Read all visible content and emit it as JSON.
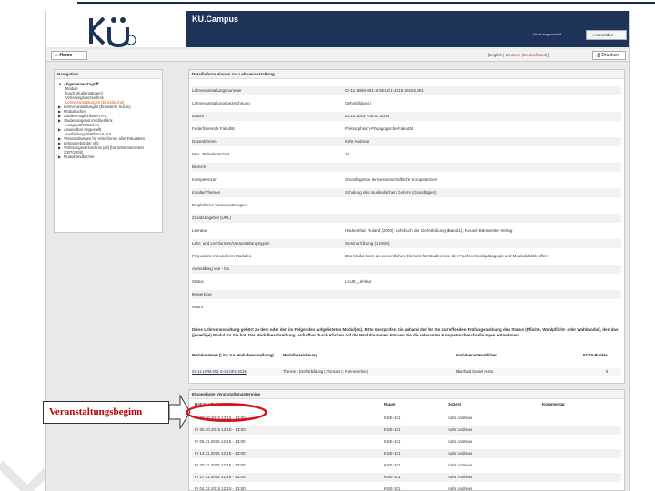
{
  "colors": {
    "banner": "#1e3358",
    "highlight": "#d8141b",
    "annotation_text": "#c00000",
    "selected_nav": "#d35400"
  },
  "header": {
    "logo_text": "KU",
    "app_title": "KU.Campus",
    "not_logged_in": "Nicht angemeldet",
    "login_label": "Anmelden",
    "login_icon": "login-icon"
  },
  "toolbar": {
    "home_label": "Home",
    "home_icon": "home-icon",
    "lang_english": "English",
    "lang_german": "Deutsch (Deutschland)",
    "print_label": "Drucken",
    "print_icon": "printer-icon"
  },
  "navigation": {
    "title": "Navigation",
    "items": [
      {
        "label": "Allgemeiner Zugriff"
      },
      {
        "label": "Module"
      },
      {
        "label": "[nach Studiengängen]"
      },
      {
        "label": "Vorlesungsverzeichnis"
      },
      {
        "label": "Lehrveranstaltungen [Einzelsuche]"
      },
      {
        "label": "Lehrveranstaltungen [Erweiterte Suche]"
      },
      {
        "label": "Modulsuchen"
      },
      {
        "label": "Studienmöglichkeiten A-Z"
      },
      {
        "label": "Studienangebot im Überblick"
      },
      {
        "label": "Ausgewählt löschen"
      },
      {
        "label": "Anwendbar eingestellt"
      },
      {
        "label": "Ausbildung-Plattform ILIAS"
      },
      {
        "label": "Veranstaltungen für Hörer/innen aller Fakultäten"
      },
      {
        "label": "Lehrangebot der vhb"
      },
      {
        "label": "Vorlesungsverzeichnis (alt) [bis Wintersemester 2007/2008]"
      },
      {
        "label": "Modulhandbücher"
      }
    ]
  },
  "details": {
    "title": "Detailinformationen zur Lehrveranstaltung",
    "rows": [
      {
        "label": "Lehrveranstaltungsnummer",
        "value": "02-11-LWM-001-S-SEUE1-2015-20152.001"
      },
      {
        "label": "Lehrveranstaltungsbezeichnung",
        "value": "Gehörbildung I"
      },
      {
        "label": "Datum",
        "value": "23.10.2015 - 05.02.2016"
      },
      {
        "label": "Federführende Fakultät",
        "value": "Philosophisch-Pädagogische Fakultät"
      },
      {
        "label": "Dozent/innen",
        "value": "Kahr Andreas"
      },
      {
        "label": "Max. Teilnehmerzahl",
        "value": "10"
      },
      {
        "label": "Bereich",
        "value": ""
      },
      {
        "label": "Kompetenzen",
        "value": "Grundlegende lernwissenschaftliche Kompetenzen"
      },
      {
        "label": "Inhalte/Themen",
        "value": "Schulung des musikalischen Gehörs (Grundlagen)"
      },
      {
        "label": "Empfohlene Voraussetzungen",
        "value": ""
      },
      {
        "label": "Zusatzangebot (URL)",
        "value": ""
      },
      {
        "label": "Literatur",
        "value": "Hackenthal, Roland (2000): Lehrbuch der Gehörbildung (Band 1), Kassel: Bärenreiter-Verlag"
      },
      {
        "label": "Lehr- und Lernformen/Veranstaltungstypen",
        "value": "Seminar/Übung (1 SWS)"
      },
      {
        "label": "Polyvalenz mit anderen Modulen",
        "value": "Das Modul kann als wesentliches Element für Studierende des Faches Musikpädagogik und Musikdidaktik offen"
      },
      {
        "label": "Anmeldung von - bis",
        "value": ""
      },
      {
        "label": "Status",
        "value": "LKUE_Lehrkur"
      },
      {
        "label": "Bewertung",
        "value": ""
      },
      {
        "label": "Raum",
        "value": ""
      }
    ],
    "notice": "Diese Lehrveranstaltung gehört zu dem oder den im Folgenden aufgelisteten Modul(en). Bitte überprüfen Sie anhand der für Sie zutreffenden Prüfungsordnung den Status (Pflicht-, Wahlpflicht- oder Wahlmodul), den das (jeweilige) Modul für Sie hat. Der Modulbeschreibung (aufrufbar durch Klicken auf die Modulnummer) können Sie die relevanten Kompetenzbeschreibungen entnehmen.",
    "module_table": {
      "headers": [
        "Modulnummer (Link zur Modulbeschreibung)",
        "Modulbezeichnung",
        "Modulverantwortlicher",
        "ECTS-Punkte"
      ],
      "row": [
        "02-11-LWM-001-S-SEUE1-2015",
        "Theorie I (Gehörbildung I; Tonsatz I; Formenlehre)",
        "Eberhard Daniel Hans",
        "6"
      ]
    }
  },
  "schedule": {
    "title": "Eingeplante Veranstaltungstermine",
    "headers": [
      "Datum / Zeit",
      "Raum",
      "Dozent",
      "Kommentar"
    ],
    "rows": [
      {
        "date": "Fr 23.10.2015 12:15 - 13:00",
        "room": "KGE-101",
        "lecturer": "Kahr Andreas"
      },
      {
        "date": "Fr 30.10.2015 12:15 - 13:00",
        "room": "KGE-101",
        "lecturer": "Kahr Andreas"
      },
      {
        "date": "Fr 06.11.2015 12:15 - 13:00",
        "room": "KGE-101",
        "lecturer": "Kahr Andreas"
      },
      {
        "date": "Fr 13.11.2015 12:15 - 13:00",
        "room": "KGE-101",
        "lecturer": "Kahr Andreas"
      },
      {
        "date": "Fr 20.11.2015 12:15 - 13:00",
        "room": "KGE-101",
        "lecturer": "Kahr Andreas"
      },
      {
        "date": "Fr 27.11.2015 12:15 - 13:00",
        "room": "KGE-101",
        "lecturer": "Kahr Andreas"
      },
      {
        "date": "Fr 04.12.2015 12:15 - 13:00",
        "room": "KGE-101",
        "lecturer": "Kahr Andreas"
      }
    ]
  },
  "annotation": {
    "label": "Veranstaltungsbeginn"
  }
}
